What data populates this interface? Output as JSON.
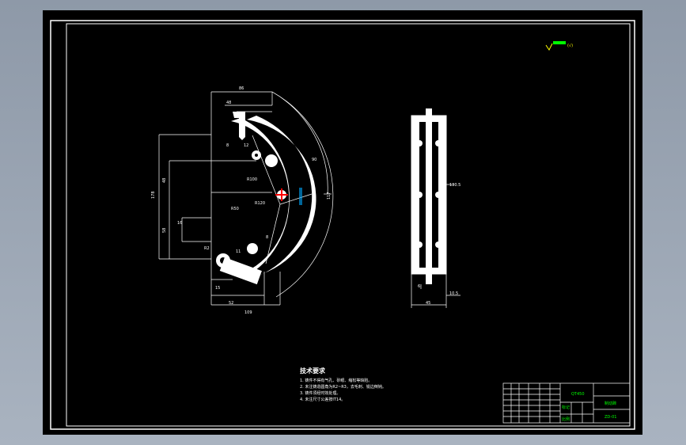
{
  "colors": {
    "background": "#000000",
    "lines": "#ffffff",
    "accent_yellow": "#ffff00",
    "accent_green": "#00ff00",
    "accent_red": "#ff0000",
    "accent_cyan": "#00ffff"
  },
  "front_view_dims": {
    "top_width": "86",
    "inner_top": "48",
    "left_height": "178",
    "mid_height": "48",
    "lower_height": "58",
    "angle_radius": "R50",
    "r1": "R100",
    "r2": "R120",
    "bottom_width": "52",
    "bottom_total": "109",
    "bottom_left": "15",
    "right_height": "117",
    "arc_dim": "90",
    "small_dim_1": "8",
    "small_dim_2": "16",
    "small_dim_3": "11",
    "small_dim_4": "8",
    "small_dim_5": "12",
    "small_dim_6": "R2"
  },
  "side_view_dims": {
    "height_label": "130.5",
    "bottom_width": "45",
    "bottom_right": "10.5",
    "small_left": "6"
  },
  "roughness_note": "(√)",
  "tech_req": {
    "title": "技术要求",
    "lines": [
      "1. 铸件不得有气孔、砂眼、缩松等缺陷。",
      "2. 未注铸造圆角为R2~R3，去毛刺、锐边倒钝。",
      "3. 铸件须经时效处理。",
      "4. 未注尺寸公差按IT14。"
    ]
  },
  "title_block": {
    "material": "QT450",
    "part_name": "制动蹄",
    "drawing_no": "ZD-01",
    "label_a": "标记",
    "label_b": "比例"
  }
}
